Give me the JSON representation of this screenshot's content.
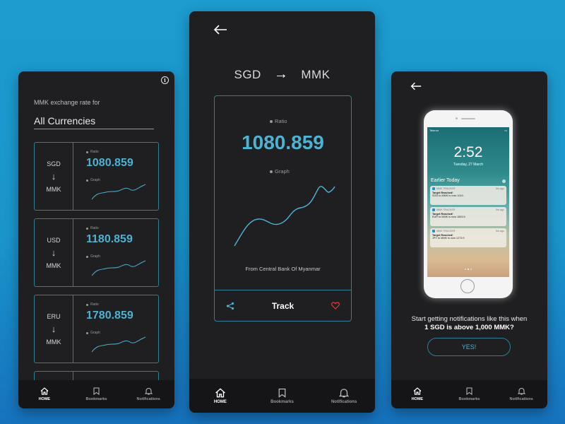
{
  "colors": {
    "accent": "#4db3d2",
    "card_border": "#2d7f98",
    "screen_bg": "#1f1f21",
    "heart": "#e0393e"
  },
  "nav": [
    {
      "label": "HOME",
      "icon": "home-icon",
      "active": true
    },
    {
      "label": "Bookmarks",
      "icon": "bookmark-icon",
      "active": false
    },
    {
      "label": "Notifications",
      "icon": "bell-icon",
      "active": false
    }
  ],
  "screen1": {
    "info_icon": "i",
    "rate_for": "MMK exchange rate for",
    "selected_currency": "All Currencies",
    "ratio_label": "Ratio",
    "graph_label": "Graph",
    "cards": [
      {
        "from": "SGD",
        "arrow": "↓",
        "to": "MMK",
        "value": "1080.859"
      },
      {
        "from": "USD",
        "arrow": "↓",
        "to": "MMK",
        "value": "1180.859"
      },
      {
        "from": "ERU",
        "arrow": "↓",
        "to": "MMK",
        "value": "1780.859"
      }
    ]
  },
  "screen2": {
    "back_icon": "back-arrow-icon",
    "from": "SGD",
    "arrow": "→",
    "to": "MMK",
    "ratio_label": "Ratio",
    "value": "1080.859",
    "graph_label": "Graph",
    "source": "From Central Bank Of Myanmar",
    "track_label": "Track",
    "share_icon": "share-icon",
    "heart_icon": "heart-icon"
  },
  "screen3": {
    "phone": {
      "carrier": "Telenor",
      "time": "2:52",
      "date": "Tuesday, 27 March",
      "section": "Earlier Today",
      "notifications": [
        {
          "app": "MMK TRACKER",
          "ago": "5m ago",
          "title": "Target Reached!",
          "body": "SGD to MMK is now 1010."
        },
        {
          "app": "MMK TRACKER",
          "ago": "5m ago",
          "title": "Target Reached!",
          "body": "EUR to MMK is now 1653.5"
        },
        {
          "app": "MMK TRACKER",
          "ago": "5m ago",
          "title": "Target Reached!",
          "body": "JPY to MMK is now 1273.9"
        }
      ]
    },
    "promo_line1": "Start getting notifications like this when",
    "promo_line2": "1 SGD is above 1,000 MMK?",
    "yes_label": "YES!"
  }
}
